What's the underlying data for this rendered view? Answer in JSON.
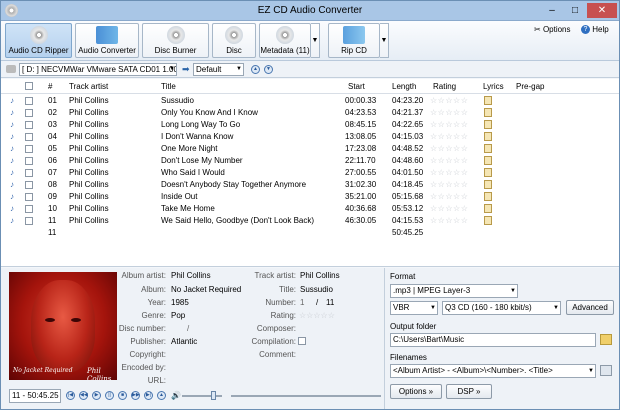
{
  "window": {
    "title": "EZ CD Audio Converter",
    "min": "–",
    "max": "□",
    "close": "✕"
  },
  "toolbar": {
    "buttons": [
      {
        "label": "Audio CD Ripper"
      },
      {
        "label": "Audio Converter"
      },
      {
        "label": "Disc Burner"
      },
      {
        "label": "Disc"
      },
      {
        "label": "Metadata (11)"
      },
      {
        "label": "Rip CD"
      }
    ],
    "options": "Options",
    "help": "Help",
    "split_arrow": "▼"
  },
  "drive": {
    "selected": "[ D: ] NECVMWar VMware SATA CD01 1.00",
    "profile": "Default",
    "arrow": "➡",
    "dd": "▼",
    "up": "▲",
    "down": "▼"
  },
  "tracks": {
    "headers": [
      "#",
      "Track artist",
      "Title",
      "Start",
      "Length",
      "Rating",
      "Lyrics",
      "Pre-gap"
    ],
    "rows": [
      {
        "num": "01",
        "artist": "Phil Collins",
        "title": "Sussudio",
        "start": "00:00.33",
        "length": "04:23.20"
      },
      {
        "num": "02",
        "artist": "Phil Collins",
        "title": "Only You Know And I Know",
        "start": "04:23.53",
        "length": "04:21.37"
      },
      {
        "num": "03",
        "artist": "Phil Collins",
        "title": "Long Long Way To Go",
        "start": "08:45.15",
        "length": "04:22.65"
      },
      {
        "num": "04",
        "artist": "Phil Collins",
        "title": "I Don't Wanna Know",
        "start": "13:08.05",
        "length": "04:15.03"
      },
      {
        "num": "05",
        "artist": "Phil Collins",
        "title": "One More Night",
        "start": "17:23.08",
        "length": "04:48.52"
      },
      {
        "num": "06",
        "artist": "Phil Collins",
        "title": "Don't Lose My Number",
        "start": "22:11.70",
        "length": "04:48.60"
      },
      {
        "num": "07",
        "artist": "Phil Collins",
        "title": "Who Said I Would",
        "start": "27:00.55",
        "length": "04:01.50"
      },
      {
        "num": "08",
        "artist": "Phil Collins",
        "title": "Doesn't Anybody Stay Together Anymore",
        "start": "31:02.30",
        "length": "04:18.45"
      },
      {
        "num": "09",
        "artist": "Phil Collins",
        "title": "Inside Out",
        "start": "35:21.00",
        "length": "05:15.68"
      },
      {
        "num": "10",
        "artist": "Phil Collins",
        "title": "Take Me Home",
        "start": "40:36.68",
        "length": "05:53.12"
      },
      {
        "num": "11",
        "artist": "Phil Collins",
        "title": "We Said Hello, Goodbye (Don't Look Back)",
        "start": "46:30.05",
        "length": "04:15.53"
      }
    ],
    "total_count": "11",
    "total_length": "50:45.25",
    "stars": "☆☆☆☆☆",
    "note": "♪"
  },
  "cover": {
    "left_text": "No Jacket Required",
    "right_text": "Phil Collins"
  },
  "metadata": {
    "album_artist_label": "Album artist:",
    "album_artist": "Phil Collins",
    "album_label": "Album:",
    "album": "No Jacket Required",
    "year_label": "Year:",
    "year": "1985",
    "genre_label": "Genre:",
    "genre": "Pop",
    "disc_number_label": "Disc number:",
    "disc_sep": "/",
    "publisher_label": "Publisher:",
    "publisher": "Atlantic",
    "copyright_label": "Copyright:",
    "encoded_by_label": "Encoded by:",
    "url_label": "URL:",
    "track_artist_label": "Track artist:",
    "track_artist": "Phil Collins",
    "title_label": "Title:",
    "title": "Sussudio",
    "number_label": "Number:",
    "number": "1",
    "number_sep": "/",
    "number_total": "11",
    "rating_label": "Rating:",
    "composer_label": "Composer:",
    "compilation_label": "Compilation:",
    "comment_label": "Comment:"
  },
  "player": {
    "position": "11 - 50:45.25",
    "vol_icon": "🔊",
    "volume": 0.8
  },
  "format": {
    "format_label": "Format",
    "format": ".mp3 | MPEG Layer-3",
    "mode": "VBR",
    "quality": "Q3  CD  (160 - 180 kbit/s)",
    "advanced": "Advanced",
    "output_label": "Output folder",
    "output": "C:\\Users\\Bart\\Music",
    "filenames_label": "Filenames",
    "filenames": "<Album Artist> - <Album>\\<Number>. <Title>",
    "options_btn": "Options »",
    "dsp_btn": "DSP »"
  }
}
